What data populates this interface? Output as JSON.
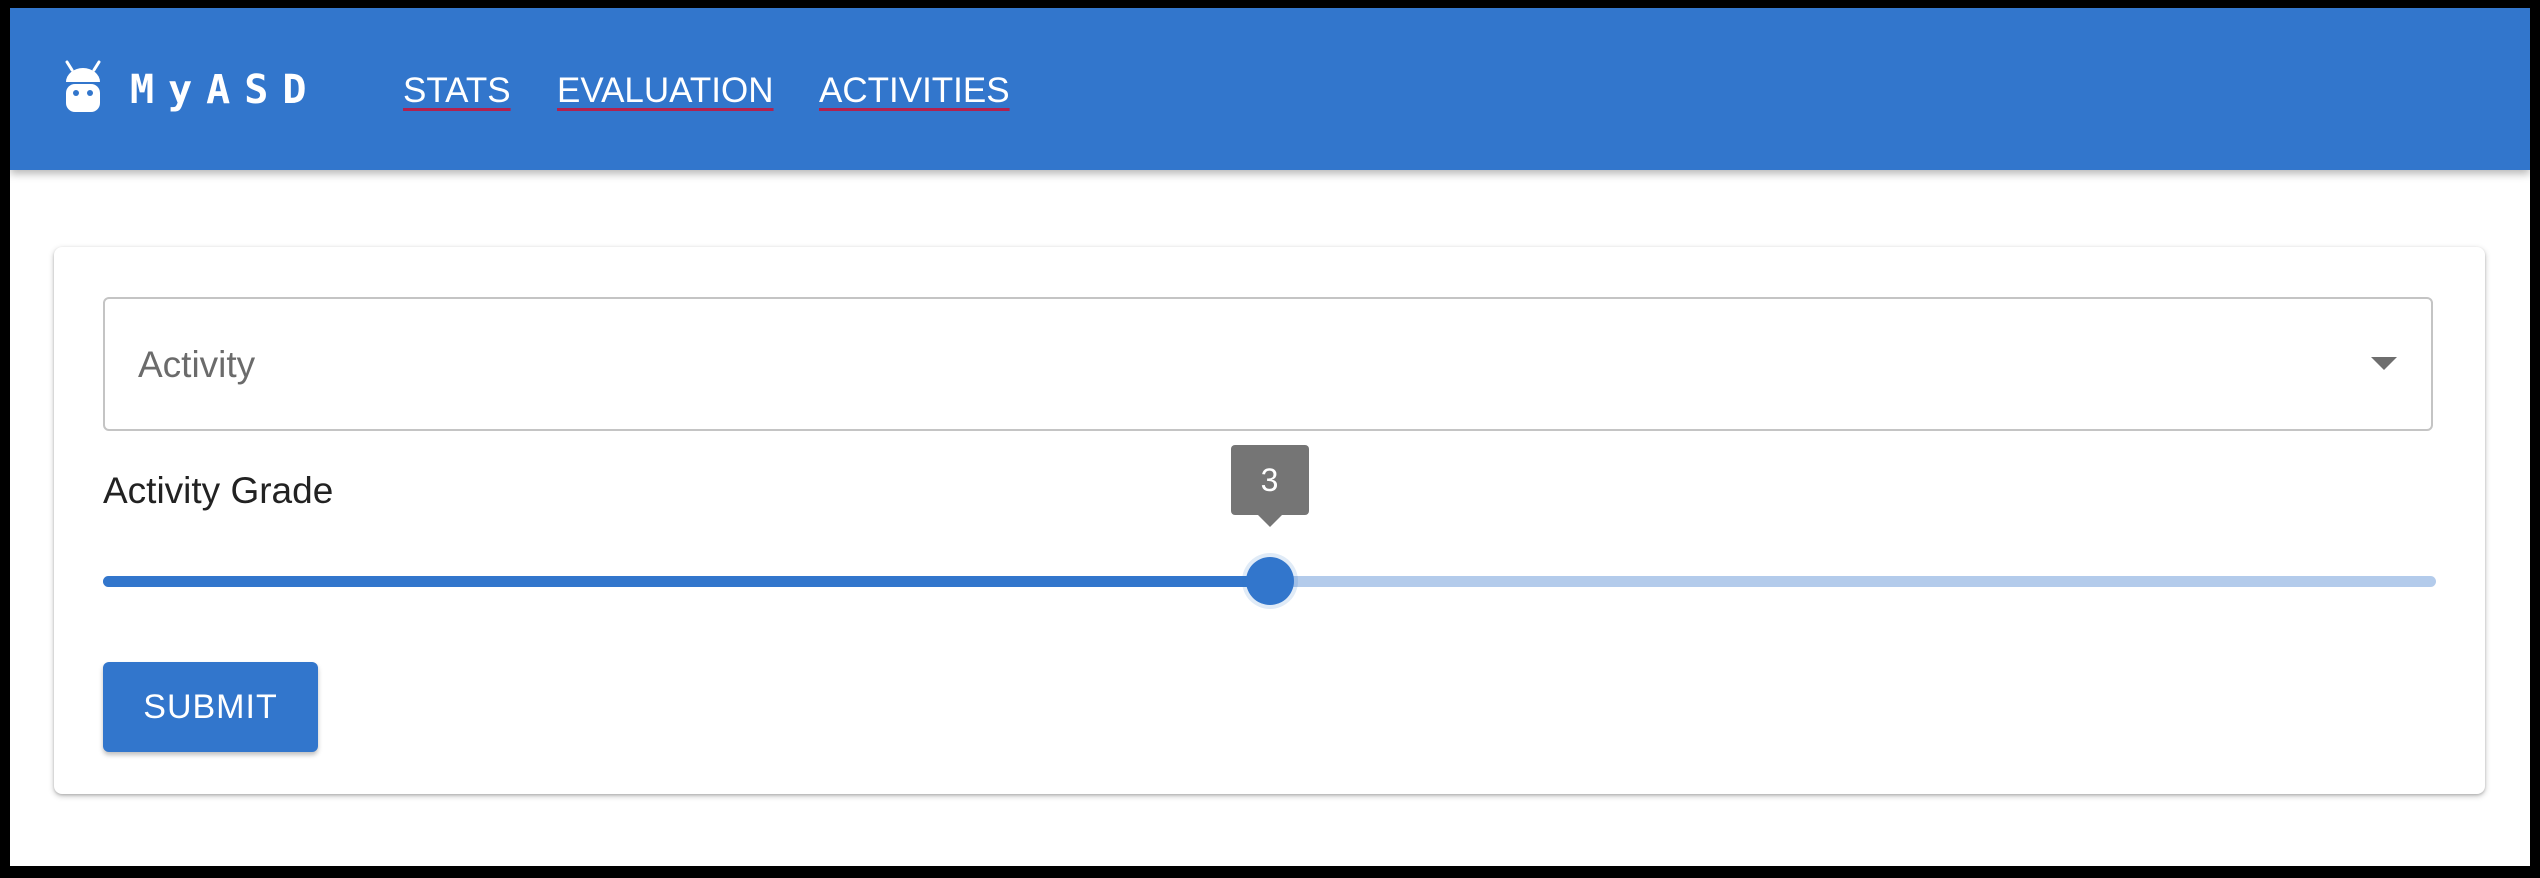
{
  "app": {
    "logo_text": "MyASD",
    "logo_icon": "android-icon"
  },
  "nav": {
    "links": [
      {
        "label": "STATS"
      },
      {
        "label": "EVALUATION"
      },
      {
        "label": "ACTIVITIES"
      }
    ]
  },
  "form": {
    "activity_select": {
      "label": "Activity",
      "value": "",
      "icon": "chevron-down-icon"
    },
    "grade": {
      "label": "Activity Grade",
      "value": 3,
      "value_text": "3",
      "min": 1,
      "max": 5
    },
    "submit_label": "SUBMIT"
  },
  "colors": {
    "primary": "#3276cc",
    "rail": "#b3cbeb",
    "tooltip": "#757575",
    "link_underline": "#b1214f"
  }
}
